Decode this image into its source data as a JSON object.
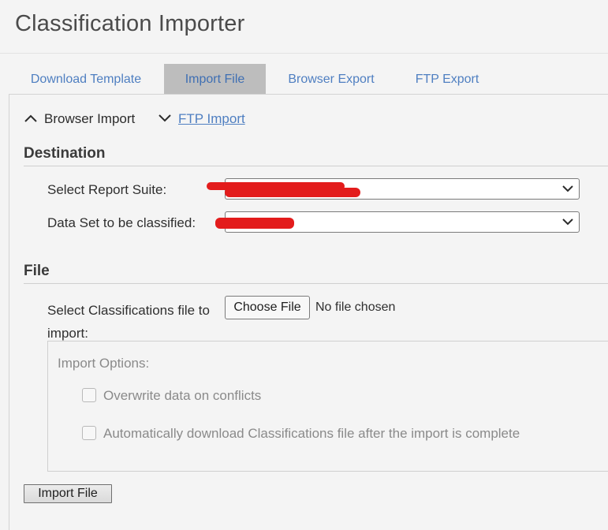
{
  "page": {
    "title": "Classification Importer"
  },
  "tabs": [
    {
      "label": "Download Template",
      "active": false
    },
    {
      "label": "Import File",
      "active": true
    },
    {
      "label": "Browser Export",
      "active": false
    },
    {
      "label": "FTP Export",
      "active": false
    }
  ],
  "import_toggles": {
    "browser_import": {
      "label": "Browser Import",
      "state": "expanded"
    },
    "ftp_import": {
      "label": "FTP Import",
      "state": "collapsed"
    }
  },
  "destination": {
    "title": "Destination",
    "report_suite": {
      "label": "Select Report Suite:",
      "value": ""
    },
    "data_set": {
      "label": "Data Set to be classified:",
      "value": ""
    }
  },
  "file": {
    "title": "File",
    "select_label": "Select Classifications file to import:",
    "choose_button": "Choose File",
    "status": "No file chosen",
    "options": {
      "title": "Import Options:",
      "overwrite": {
        "label": "Overwrite data on conflicts",
        "checked": false
      },
      "auto_download": {
        "label": "Automatically download Classifications file after the import is complete",
        "checked": false
      }
    }
  },
  "actions": {
    "import_button": "Import File"
  },
  "colors": {
    "link": "#4f7fc1",
    "active_tab": "#bdbdbd",
    "redaction": "#e31c1c"
  }
}
